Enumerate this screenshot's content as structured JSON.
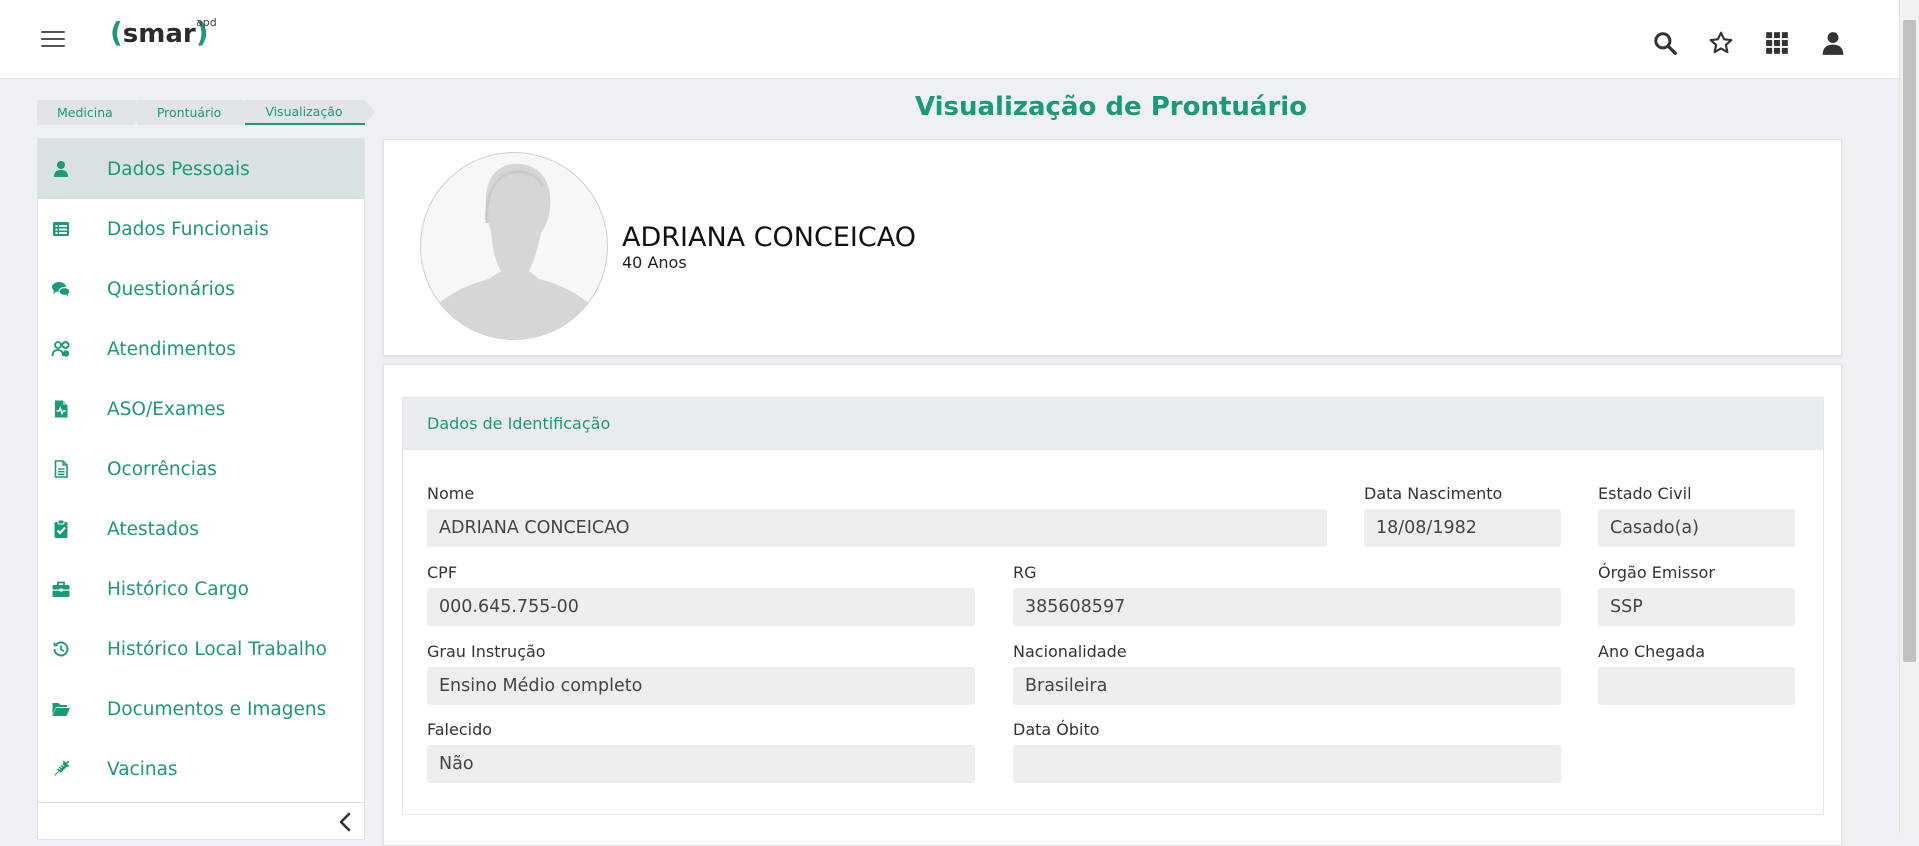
{
  "header": {
    "logo": {
      "open": "(",
      "word": "smar",
      "close": ")",
      "sup": "apd"
    },
    "icons": [
      "search-icon",
      "star-icon",
      "apps-grid-icon",
      "user-icon"
    ]
  },
  "breadcrumb": [
    "Medicina",
    "Prontuário",
    "Visualização"
  ],
  "page_title": "Visualização de Prontuário",
  "sidebar": {
    "items": [
      {
        "label": "Dados Pessoais",
        "icon": "user-icon",
        "active": true
      },
      {
        "label": "Dados Funcionais",
        "icon": "list-icon",
        "active": false
      },
      {
        "label": "Questionários",
        "icon": "comments-icon",
        "active": false
      },
      {
        "label": "Atendimentos",
        "icon": "users-medical-icon",
        "active": false
      },
      {
        "label": "ASO/Exames",
        "icon": "file-medical-icon",
        "active": false
      },
      {
        "label": "Ocorrências",
        "icon": "file-text-icon",
        "active": false
      },
      {
        "label": "Atestados",
        "icon": "clipboard-check-icon",
        "active": false
      },
      {
        "label": "Histórico Cargo",
        "icon": "briefcase-icon",
        "active": false
      },
      {
        "label": "Histórico Local Trabalho",
        "icon": "history-icon",
        "active": false
      },
      {
        "label": "Documentos e Imagens",
        "icon": "folder-open-icon",
        "active": false
      },
      {
        "label": "Vacinas",
        "icon": "syringe-icon",
        "active": false
      }
    ]
  },
  "profile": {
    "name": "ADRIANA CONCEICAO",
    "age": "40 Anos"
  },
  "identification": {
    "title": "Dados de Identificação",
    "fields": {
      "nome": {
        "label": "Nome",
        "value": "ADRIANA CONCEICAO"
      },
      "data_nascimento": {
        "label": "Data Nascimento",
        "value": "18/08/1982"
      },
      "estado_civil": {
        "label": "Estado Civil",
        "value": "Casado(a)"
      },
      "cpf": {
        "label": "CPF",
        "value": "000.645.755-00"
      },
      "rg": {
        "label": "RG",
        "value": "385608597"
      },
      "orgao_emissor": {
        "label": "Órgão Emissor",
        "value": "SSP"
      },
      "grau_instrucao": {
        "label": "Grau Instrução",
        "value": "Ensino Médio completo"
      },
      "nacionalidade": {
        "label": "Nacionalidade",
        "value": "Brasileira"
      },
      "ano_chegada": {
        "label": "Ano Chegada",
        "value": ""
      },
      "falecido": {
        "label": "Falecido",
        "value": "Não"
      },
      "data_obito": {
        "label": "Data Óbito",
        "value": ""
      }
    }
  },
  "colors": {
    "accent": "#1a9a78",
    "background": "#eef0f3",
    "active_item": "#d9e1e3"
  }
}
